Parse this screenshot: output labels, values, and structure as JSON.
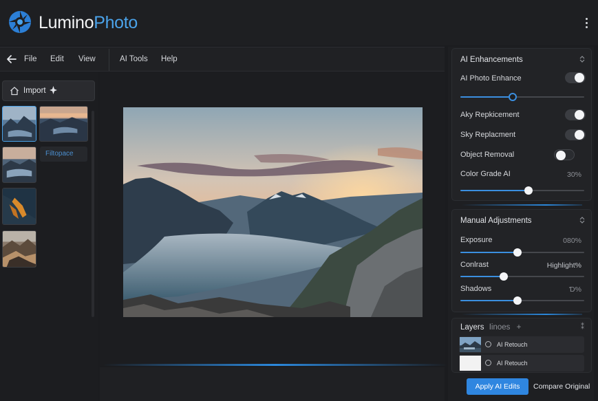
{
  "brand": {
    "name_part1": "Lumino",
    "name_part2": "Photo",
    "accent": "#4ba3ea"
  },
  "header": {
    "more_icon": "kebab-icon"
  },
  "menubar": {
    "back_icon": "arrow-left-icon",
    "items": [
      "File",
      "Edit",
      "View",
      "AI Tools",
      "Help"
    ]
  },
  "sidebar": {
    "import_label": "Import",
    "import_icon": "home-icon",
    "sparkle_icon": "sparkle-icon",
    "filter_chip": "Filtopace",
    "thumbnails": [
      "mountain-lake-dusk",
      "mountain-lake-sunset",
      "mountain-lake-clouds",
      "autumn-ridge",
      "rocky-valley"
    ]
  },
  "enhancements": {
    "title": "AI Enhancements",
    "photo_enhance_label": "AI Photo Enhance",
    "photo_enhance_on": true,
    "photo_enhance_level": 0.42,
    "sky_replacement_label_1": "Aky Repkicement",
    "sky_replacement_1_on": true,
    "sky_replacement_label_2": "Sky Replacment",
    "sky_replacement_2_on": true,
    "object_removal_label": "Object Removal",
    "object_removal_on": false,
    "color_grade_label": "Color Grade AI",
    "color_grade_value": "30%",
    "color_grade_level": 0.55
  },
  "manual": {
    "title": "Manual Adjustments",
    "exposure_label": "Exposure",
    "exposure_value": "080%",
    "exposure_level": 0.46,
    "contrast_label": "Conlrast",
    "contrast_value": "Highlight%",
    "contrast_level": 0.35,
    "shadows_label": "Shadows",
    "shadows_value": "Ɗ%",
    "shadows_level": 0.46
  },
  "layers": {
    "title": "Layers",
    "subtitle": "Iinoes",
    "add_symbol": "+",
    "collapse_symbol": "⁑",
    "items": [
      {
        "name": "AI Retouch",
        "thumb": "mountain"
      },
      {
        "name": "AI Retouch",
        "thumb": "blank"
      }
    ]
  },
  "actions": {
    "apply_label": "Apply AI Edits",
    "compare_label": "Compare Original"
  },
  "colors": {
    "accent_blue": "#2f86e0",
    "panel_bg": "#222326",
    "app_bg": "#1b1c1f"
  }
}
